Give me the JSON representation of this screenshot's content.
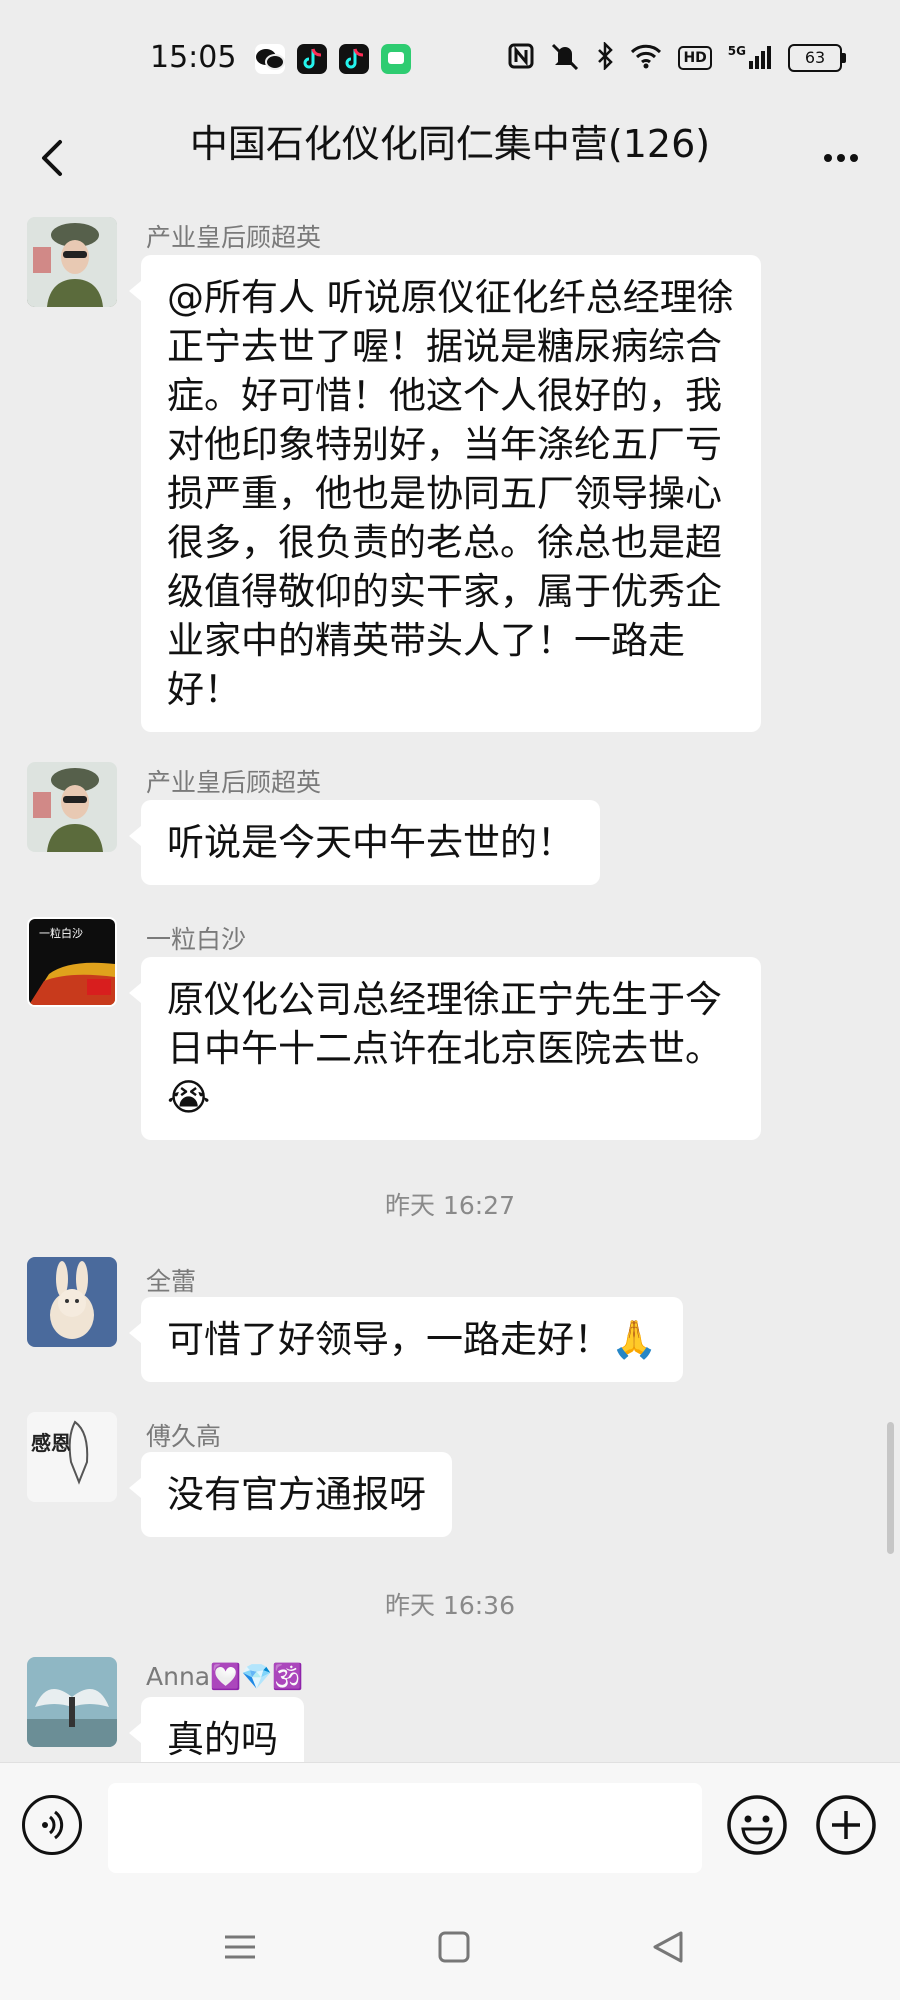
{
  "status": {
    "time": "15:05",
    "signal_label": "5G",
    "hd_label": "HD",
    "battery": "63"
  },
  "header": {
    "title": "中国石化仪化同仁集中营(126)"
  },
  "messages": [
    {
      "sender": "产业皇后顾超英",
      "text": "@所有人  听说原仪征化纤总经理徐正宁去世了喔！据说是糖尿病综合症。好可惜！他这个人很好的，我对他印象特别好，当年涤纶五厂亏损严重，他也是协同五厂领导操心很多，很负责的老总。徐总也是超级值得敬仰的实干家，属于优秀企业家中的精英带头人了！一路走好！"
    },
    {
      "sender": "产业皇后顾超英",
      "text": "听说是今天中午去世的！"
    },
    {
      "sender": "一粒白沙",
      "avatar_text": "一粒白沙",
      "text": "原仪化公司总经理徐正宁先生于今日中午十二点许在北京医院去世。😭"
    },
    {
      "timestamp": "昨天 16:27"
    },
    {
      "sender": "全蕾",
      "text": "可惜了好领导，一路走好！🙏"
    },
    {
      "sender": "傅久高",
      "avatar_text": "感恩",
      "text": "没有官方通报呀"
    },
    {
      "timestamp": "昨天 16:36"
    },
    {
      "sender": "Anna💟💎🕉️",
      "text": "真的吗"
    }
  ],
  "input": {
    "value": ""
  },
  "icons": {
    "back": "chevron-left-icon",
    "more": "more-dots-icon",
    "voice": "voice-icon",
    "emoji": "emoji-icon",
    "plus": "plus-icon",
    "nav_menu": "menu-icon",
    "nav_home": "home-icon",
    "nav_back": "nav-back-icon"
  }
}
